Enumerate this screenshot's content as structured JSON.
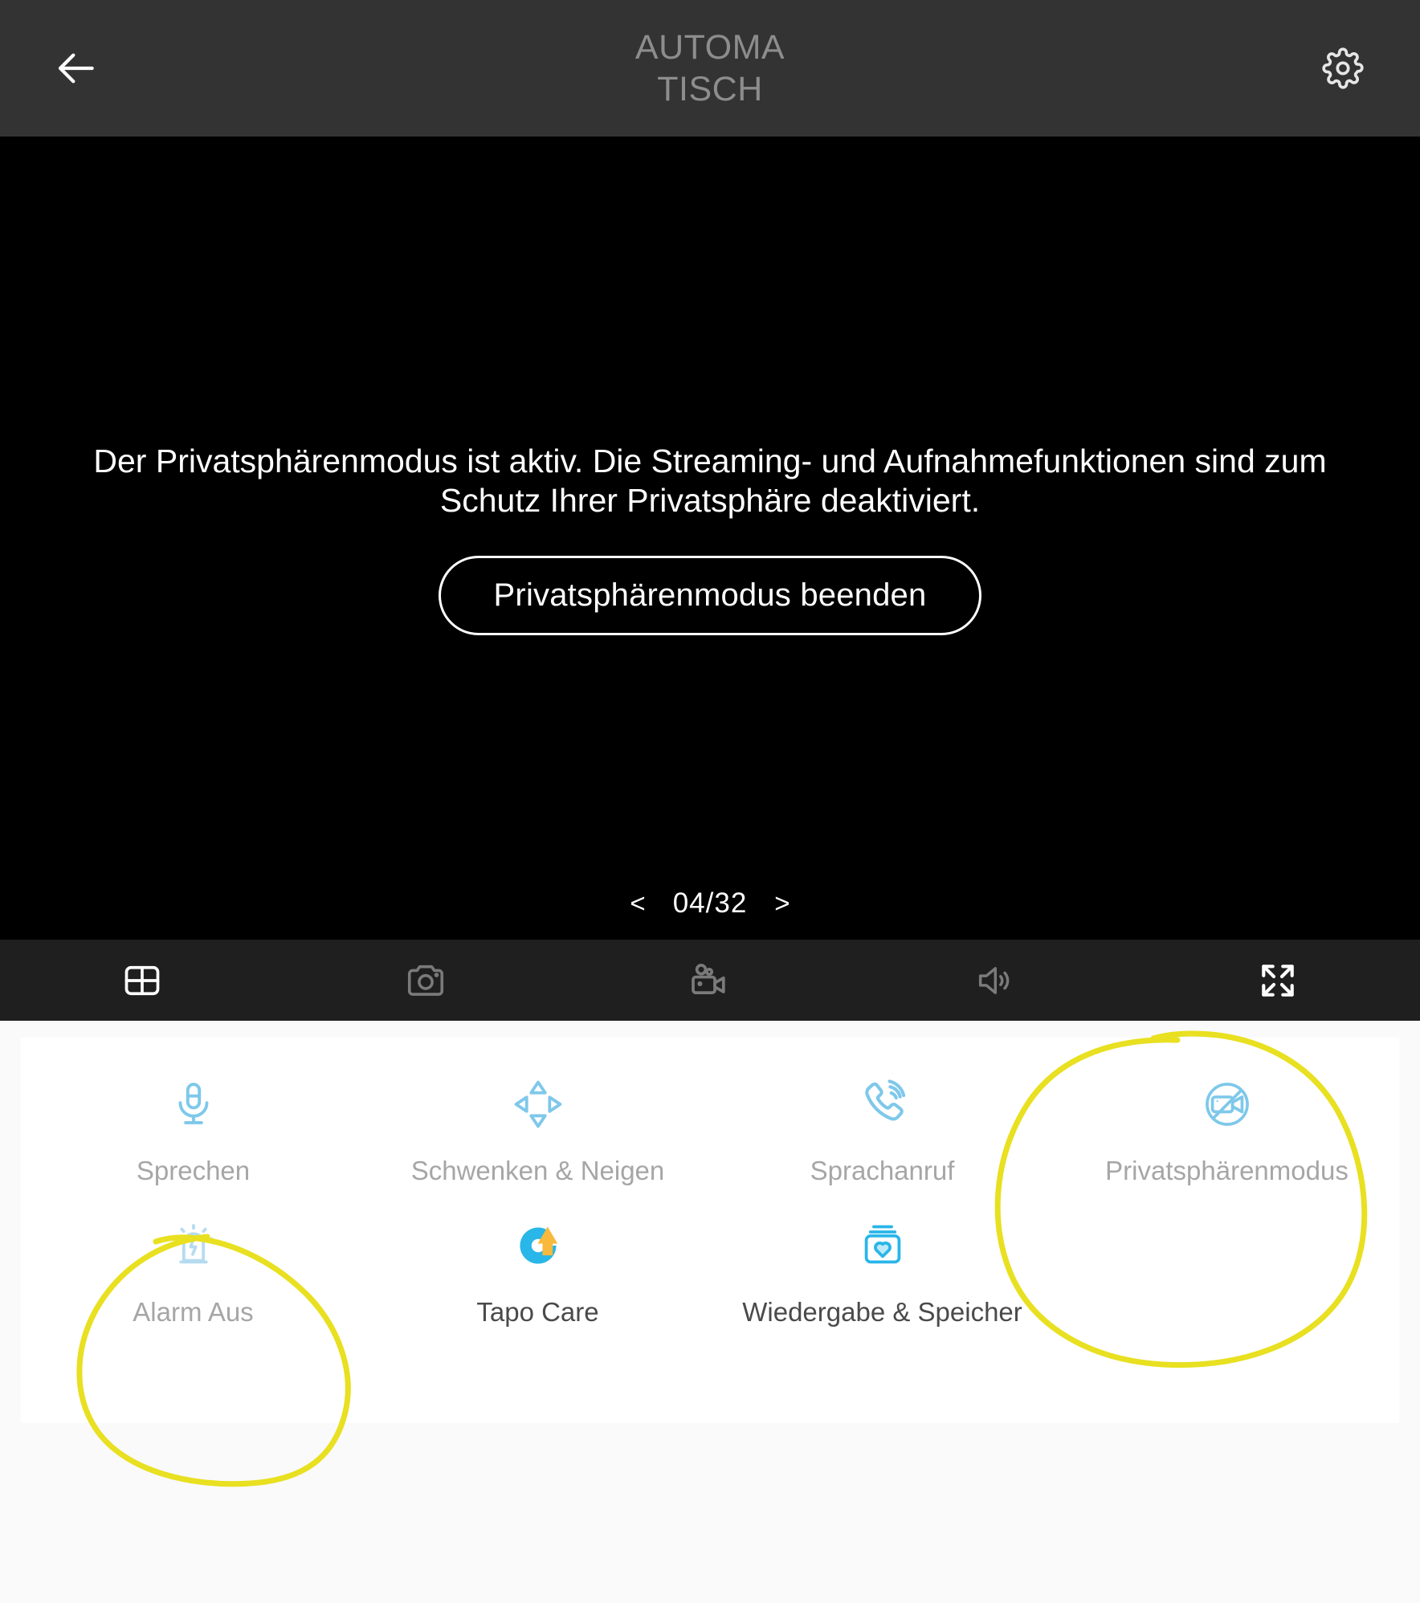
{
  "appbar": {
    "back_icon": "arrow-left-icon",
    "title": "AUTOMATISCH",
    "title_line1": "AUTOMA",
    "title_line2": "TISCH",
    "settings_icon": "gear-icon"
  },
  "video": {
    "privacy_message": "Der Privatsphärenmodus ist aktiv. Die Streaming- und Aufnahmefunktionen sind zum Schutz Ihrer Privatsphäre deaktiviert.",
    "exit_button": "Privatsphärenmodus beenden",
    "pager": {
      "prev": "<",
      "count": "04/32",
      "next": ">"
    }
  },
  "toolstrip": {
    "items": [
      {
        "name": "split-screen-icon",
        "label": "Geteilter Bildschirm",
        "state": "active"
      },
      {
        "name": "camera-snapshot-icon",
        "label": "Schnappschuss",
        "state": "disabled"
      },
      {
        "name": "video-record-icon",
        "label": "Aufnahme",
        "state": "disabled"
      },
      {
        "name": "speaker-icon",
        "label": "Ton",
        "state": "disabled"
      },
      {
        "name": "fullscreen-icon",
        "label": "Vollbild",
        "state": "active"
      }
    ]
  },
  "controls": {
    "row1": [
      {
        "icon": "microphone-icon",
        "label": "Sprechen",
        "state": "dim"
      },
      {
        "icon": "pan-tilt-icon",
        "label": "Schwenken & Neigen",
        "state": "dim"
      },
      {
        "icon": "phone-call-icon",
        "label": "Sprachanruf",
        "state": "dim"
      },
      {
        "icon": "camera-off-icon",
        "label": "Privatsphärenmodus",
        "state": "dim"
      }
    ],
    "row2": [
      {
        "icon": "alarm-siren-icon",
        "label": "Alarm Aus",
        "state": "dim"
      },
      {
        "icon": "tapo-care-icon",
        "label": "Tapo Care",
        "state": "on"
      },
      {
        "icon": "sd-card-heart-icon",
        "label": "Wiedergabe & Speicher",
        "state": "on"
      }
    ]
  },
  "annotations": {
    "circle_privacy_mode": "Privatsphärenmodus",
    "circle_alarm_off": "Alarm Aus",
    "color": "#e8e020"
  },
  "colors": {
    "appbar_bg": "#333333",
    "video_bg": "#000000",
    "toolstrip_bg": "#1f1f1f",
    "card_bg": "#ffffff",
    "page_bg": "#fafafa",
    "icon_blue": "#7ec8ea",
    "icon_blue_strong": "#29b6e8",
    "tapo_orange": "#f8b93c",
    "annotation_yellow": "#e8e020"
  }
}
